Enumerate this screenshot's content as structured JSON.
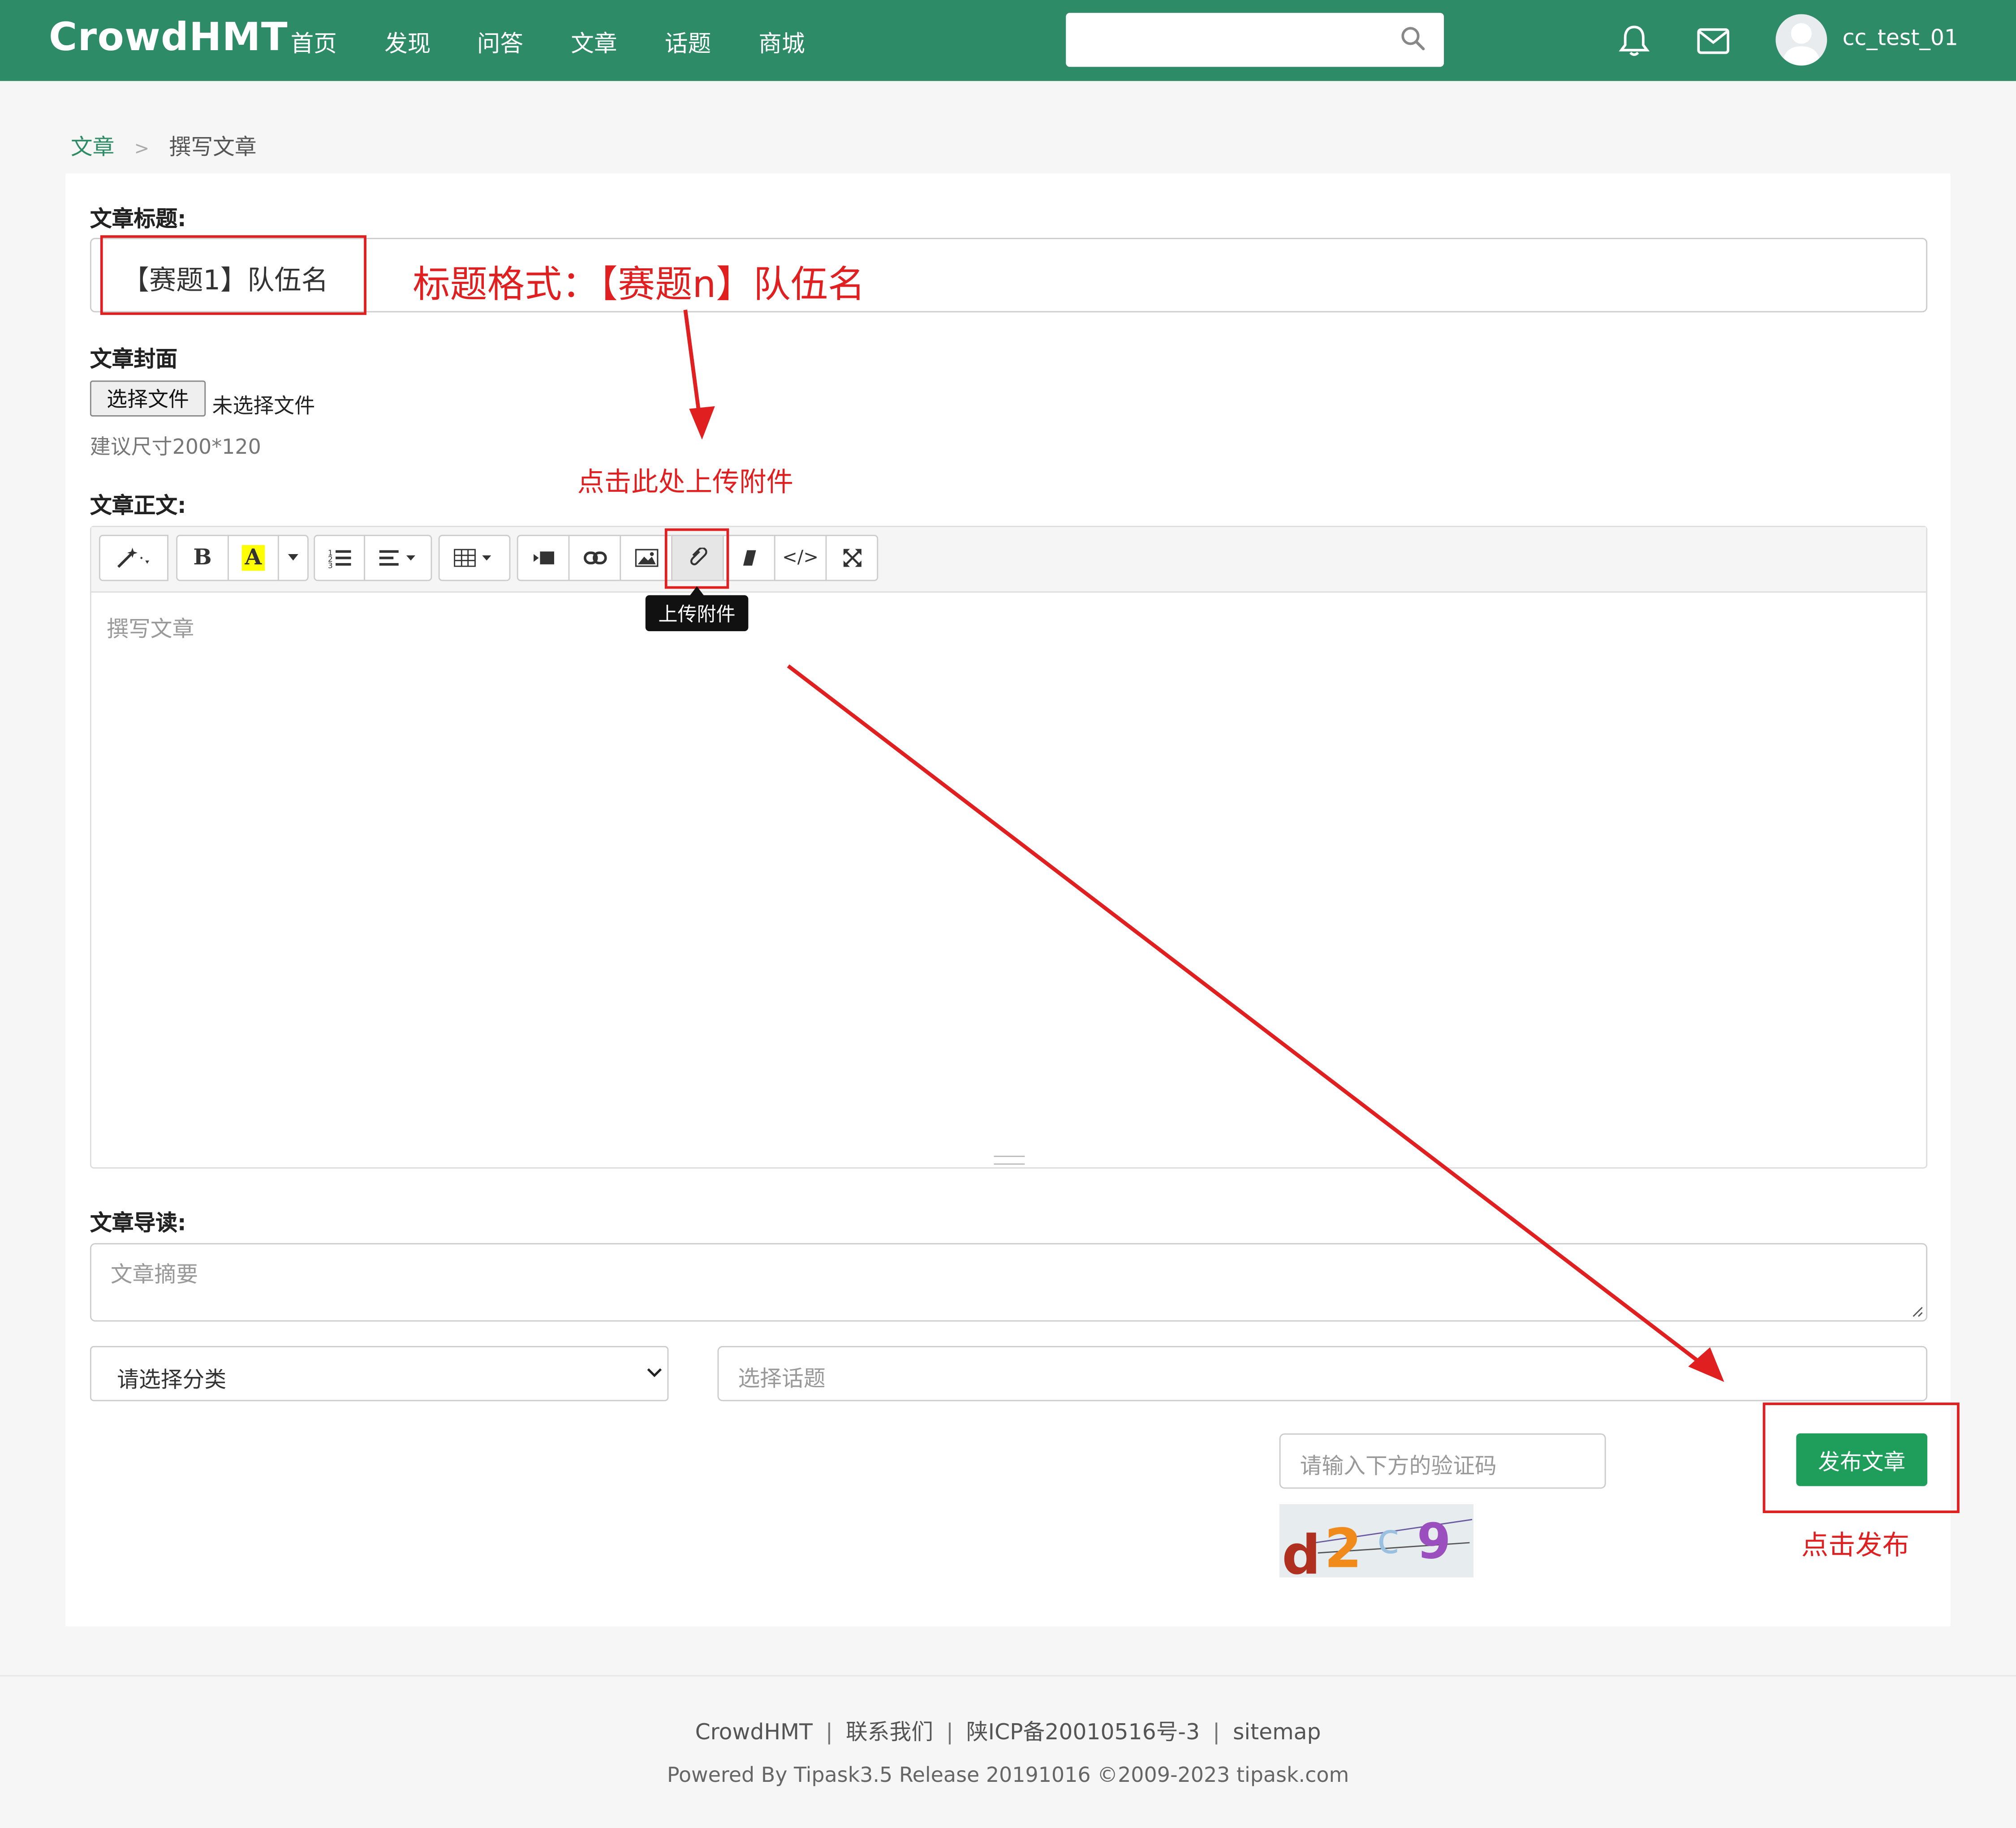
{
  "header": {
    "logo": "CrowdHMT",
    "nav": [
      "首页",
      "发现",
      "问答",
      "文章",
      "话题",
      "商城"
    ],
    "search_placeholder": "",
    "username": "cc_test_01"
  },
  "breadcrumb": {
    "parent": "文章",
    "separator": ">",
    "current": "撰写文章"
  },
  "form": {
    "title_label": "文章标题:",
    "title_value": "【赛题1】队伍名",
    "cover_label": "文章封面",
    "file_button": "选择文件",
    "file_status": "未选择文件",
    "cover_hint": "建议尺寸200*120",
    "body_label": "文章正文:",
    "body_placeholder": "撰写文章",
    "tooltip": "上传附件",
    "summary_label": "文章导读:",
    "summary_placeholder": "文章摘要",
    "category_placeholder": "请选择分类",
    "topic_placeholder": "选择话题",
    "captcha_placeholder": "请输入下方的验证码",
    "captcha_text": "d2c9",
    "publish_button": "发布文章"
  },
  "toolbar_icons": [
    "magic-wand-icon",
    "bold-icon",
    "highlight-icon",
    "ordered-list-icon",
    "align-icon",
    "table-icon",
    "video-icon",
    "link-icon",
    "image-icon",
    "paperclip-icon",
    "eraser-icon",
    "code-icon",
    "fullscreen-icon"
  ],
  "annotations": {
    "title_format": "标题格式：【赛题n】队伍名",
    "upload_hint": "点击此处上传附件",
    "publish_hint": "点击发布"
  },
  "footer": {
    "links": [
      "CrowdHMT",
      "联系我们",
      "陕ICP备20010516号-3",
      "sitemap"
    ],
    "powered": "Powered By Tipask3.5 Release 20191016 ©2009-2023 tipask.com"
  },
  "colors": {
    "brand": "#2e8b67",
    "publish": "#1e9e5a",
    "annotation": "#e02020"
  }
}
